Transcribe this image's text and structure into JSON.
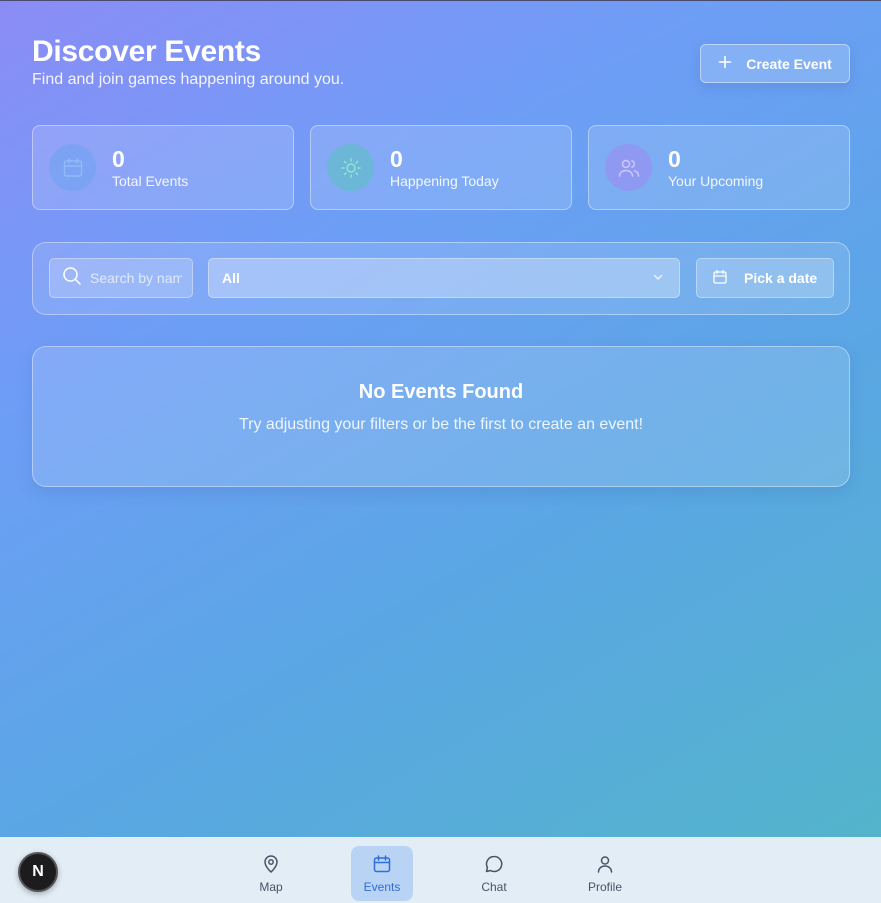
{
  "header": {
    "title": "Discover Events",
    "subtitle": "Find and join games happening around you."
  },
  "create_button": {
    "label": "Create Event",
    "icon": "plus-icon"
  },
  "stats": [
    {
      "value": "0",
      "label": "Total Events",
      "icon": "calendar-icon",
      "color": "#6ea3f3"
    },
    {
      "value": "0",
      "label": "Happening Today",
      "icon": "sun-icon",
      "color": "#5cc0c2"
    },
    {
      "value": "0",
      "label": "Your Upcoming",
      "icon": "users-icon",
      "color": "#9b8cf1"
    }
  ],
  "filters": {
    "search_placeholder": "Search by name",
    "select_value": "All",
    "date_label": "Pick a date"
  },
  "empty_state": {
    "title": "No Events Found",
    "text": "Try adjusting your filters or be the first to create an event!"
  },
  "nav": {
    "items": [
      {
        "label": "Map",
        "icon": "map-pin-icon"
      },
      {
        "label": "Events",
        "icon": "calendar-icon",
        "active": true
      },
      {
        "label": "Chat",
        "icon": "chat-bubble-icon"
      },
      {
        "label": "Profile",
        "icon": "user-icon"
      }
    ],
    "active_color": "#2f6fd6"
  },
  "avatar": {
    "initial": "N"
  }
}
